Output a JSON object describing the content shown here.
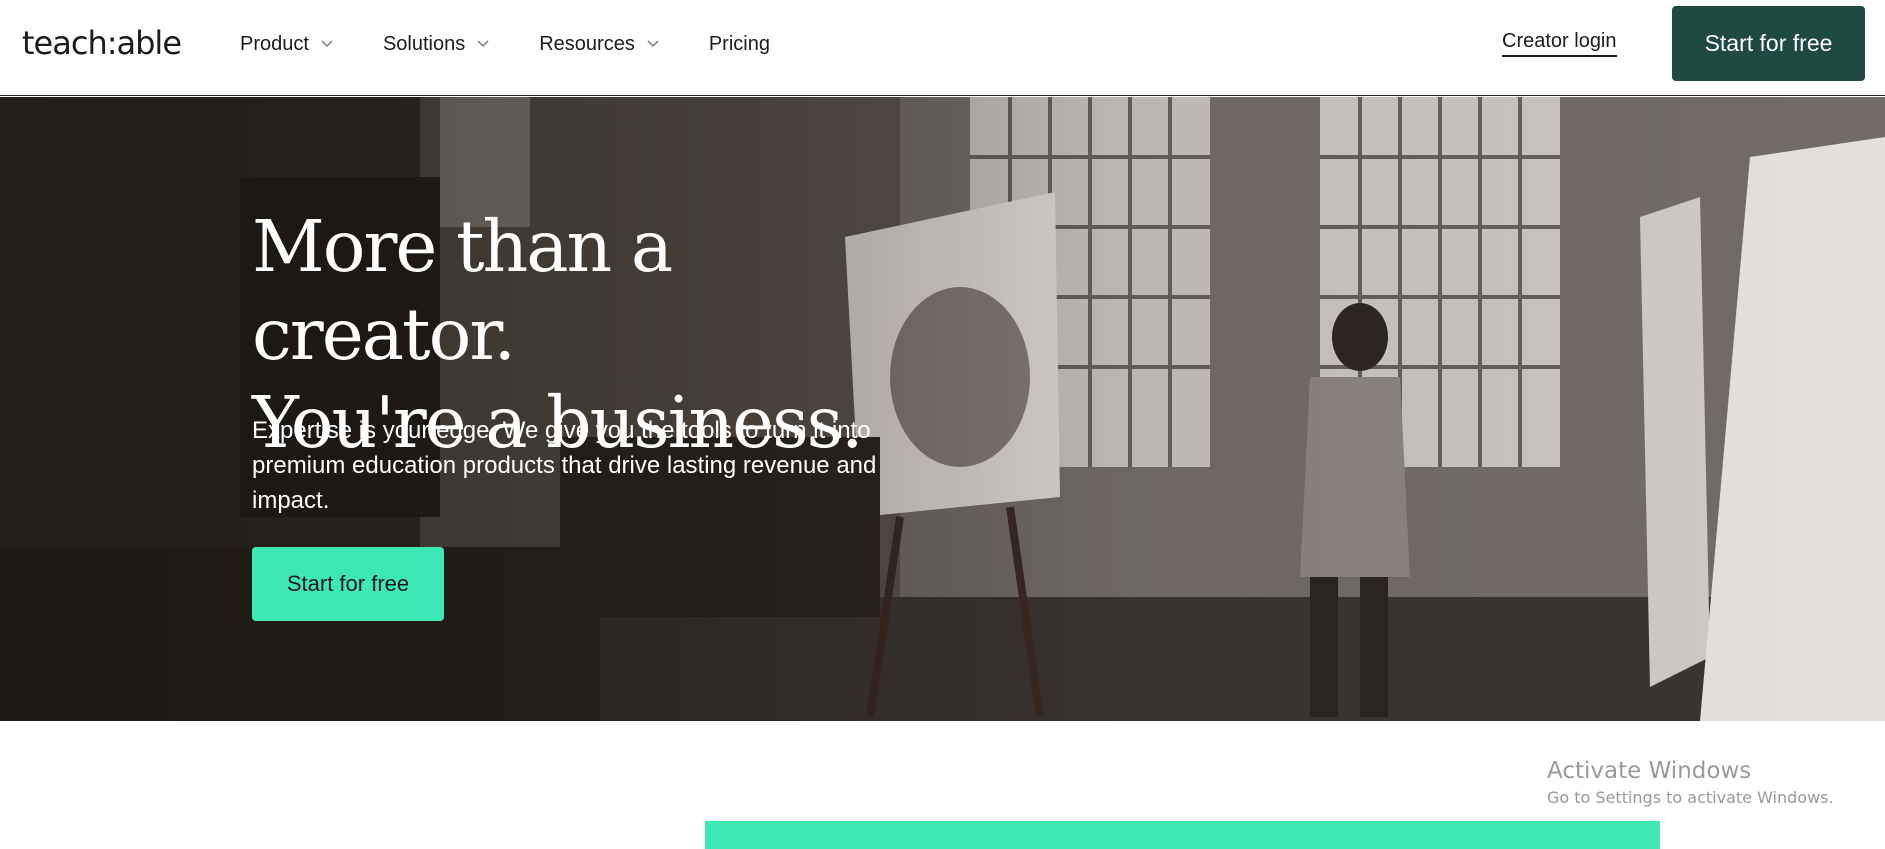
{
  "brand": {
    "logo_text": "teach:able"
  },
  "nav": {
    "items": [
      {
        "label": "Product",
        "has_dropdown": true
      },
      {
        "label": "Solutions",
        "has_dropdown": true
      },
      {
        "label": "Resources",
        "has_dropdown": true
      },
      {
        "label": "Pricing",
        "has_dropdown": false
      }
    ],
    "creator_login": "Creator login",
    "cta_label": "Start for free"
  },
  "hero": {
    "title_line1": "More than a creator.",
    "title_line2": "You're a business.",
    "subtitle": "Expertise is your edge. We give you the tools to turn it into premium education products that drive lasting revenue and impact.",
    "cta_label": "Start for free"
  },
  "watermark": {
    "line1": "Activate Windows",
    "line2": "Go to Settings to activate Windows."
  },
  "colors": {
    "nav_cta_bg": "#1e4a42",
    "hero_cta_bg": "#3ee8b5",
    "accent_bar": "#3ee8b5"
  }
}
